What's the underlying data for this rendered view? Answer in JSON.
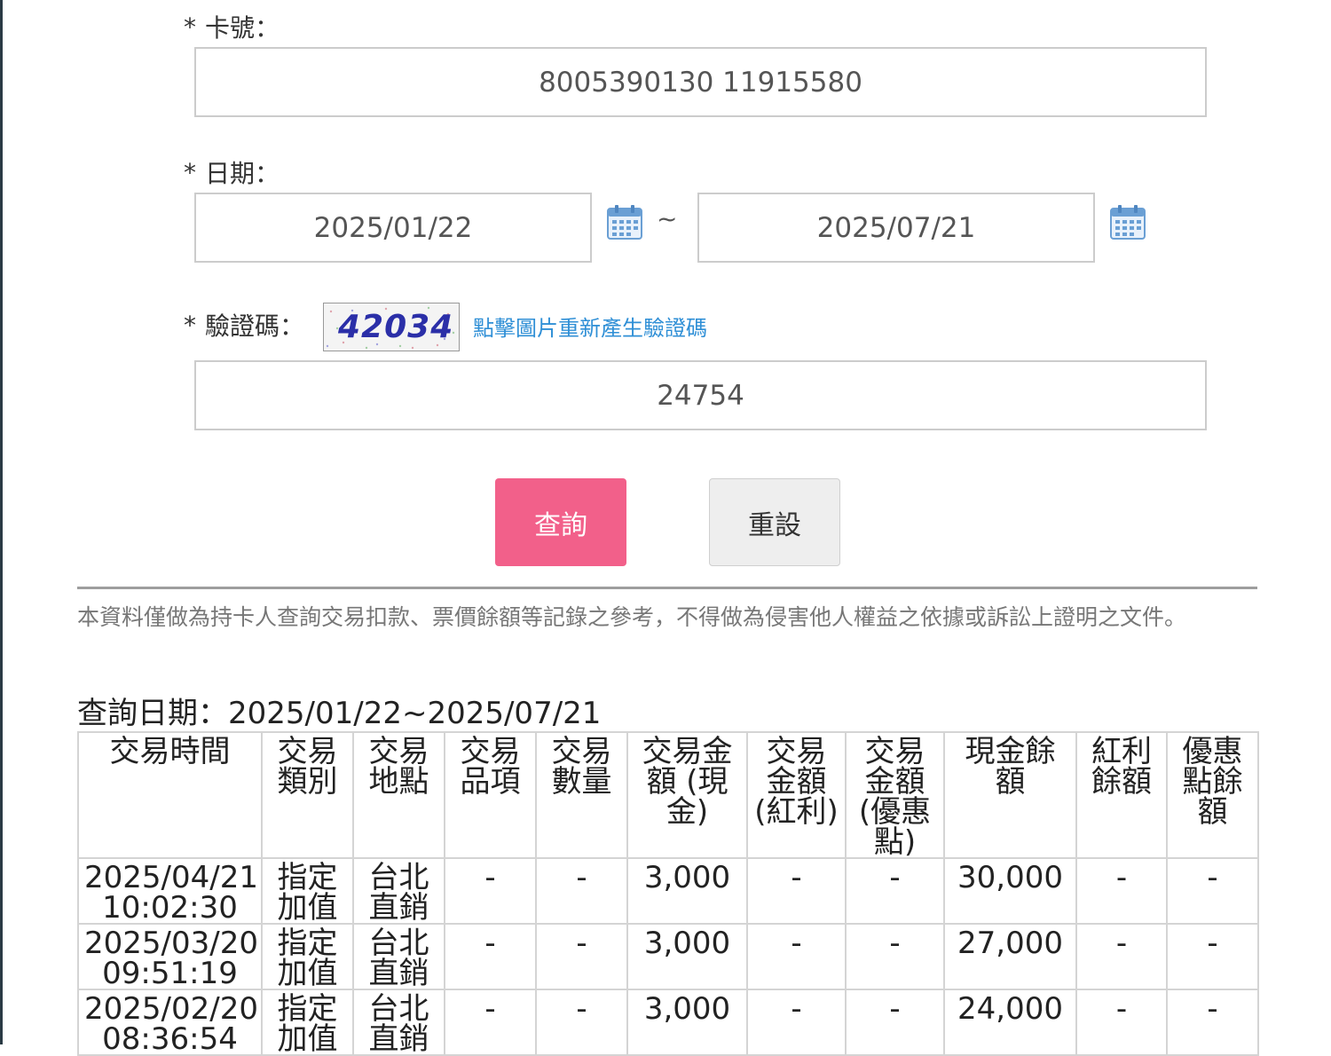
{
  "form": {
    "required_mark": "*",
    "card_label": "卡號：",
    "card_value": "8005390130 11915580",
    "date_label": "日期：",
    "date_from": "2025/01/22",
    "date_separator": "~",
    "date_to": "2025/07/21",
    "captcha_label": "驗證碼：",
    "captcha_image_text": "42034",
    "captcha_refresh_link": "點擊圖片重新產生驗證碼",
    "captcha_value": "24754",
    "query_button": "查詢",
    "reset_button": "重設"
  },
  "notice": "本資料僅做為持卡人查詢交易扣款、票價餘額等記錄之參考，不得做為侵害他人權益之依據或訴訟上證明之文件。",
  "query_date_line": "查詢日期：2025/01/22~2025/07/21",
  "table": {
    "headers": [
      "交易時間",
      "交易類別",
      "交易地點",
      "交易品項",
      "交易數量",
      "交易金額 (現金)",
      "交易金額 (紅利)",
      "交易金額 (優惠點)",
      "現金餘額",
      "紅利餘額",
      "優惠點餘額"
    ],
    "rows": [
      [
        "2025/04/21 10:02:30",
        "指定加值",
        "台北直銷",
        "-",
        "-",
        "3,000",
        "-",
        "-",
        "30,000",
        "-",
        "-"
      ],
      [
        "2025/03/20 09:51:19",
        "指定加值",
        "台北直銷",
        "-",
        "-",
        "3,000",
        "-",
        "-",
        "27,000",
        "-",
        "-"
      ],
      [
        "2025/02/20 08:36:54",
        "指定加值",
        "台北直銷",
        "-",
        "-",
        "3,000",
        "-",
        "-",
        "24,000",
        "-",
        "-"
      ]
    ]
  },
  "colors": {
    "query_button": "#f2608a",
    "reset_button": "#eeeeee",
    "link": "#2f8fd6",
    "captcha_digits": "#2b2fa8"
  }
}
